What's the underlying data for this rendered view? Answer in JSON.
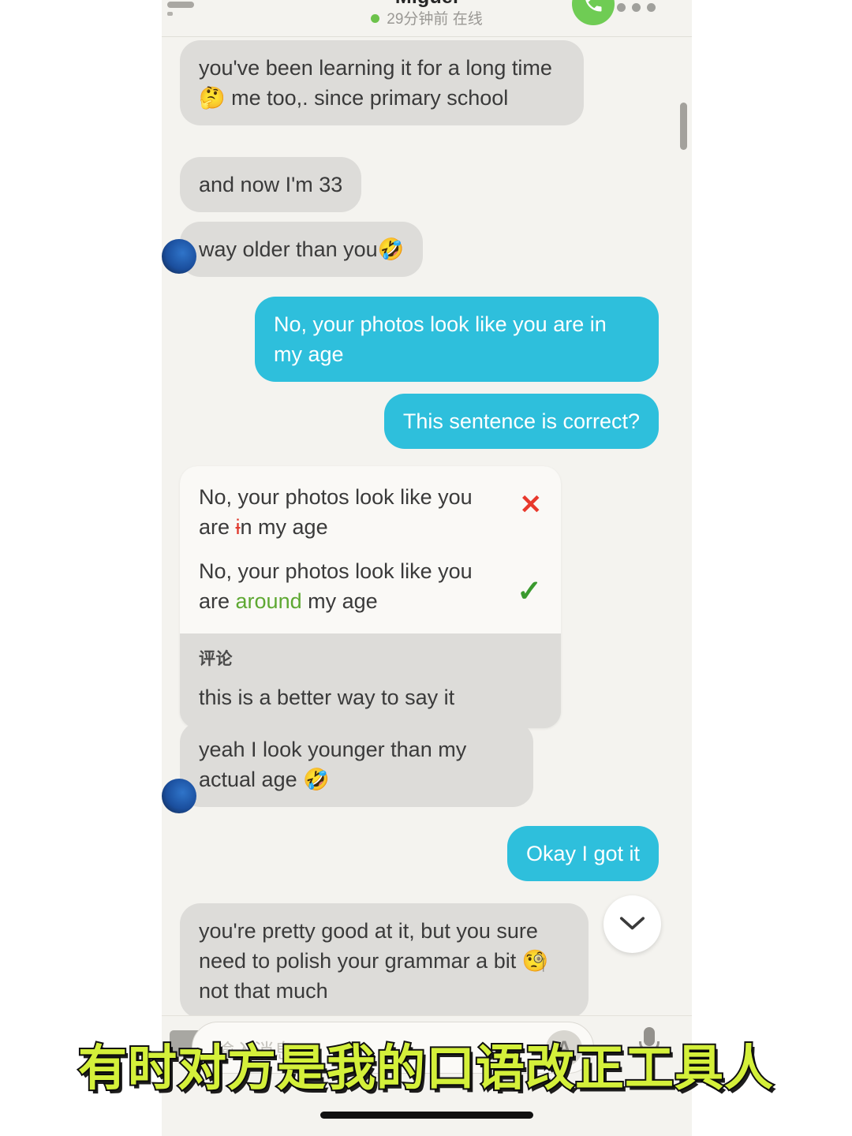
{
  "header": {
    "contact_name": "Miguel",
    "status_text": "29分钟前 在线",
    "status_dot_color": "#6cc24a",
    "call_icon": "phone-icon",
    "menu_icon": "more-options-icon",
    "back_icon": "back-arrow-icon"
  },
  "messages": [
    {
      "id": "m1",
      "side": "in",
      "text": "you've been learning it for a long time 🤔 me too,. since primary school"
    },
    {
      "id": "m2",
      "side": "in",
      "text": "and now I'm 33"
    },
    {
      "id": "m3",
      "side": "in",
      "text": "way older than you🤣"
    },
    {
      "id": "m4",
      "side": "out",
      "text": "No, your photos look like you are in my age"
    },
    {
      "id": "m5",
      "side": "out",
      "text": "This sentence is correct?"
    },
    {
      "id": "m6",
      "side": "in",
      "text": "yeah I look younger than my actual age 🤣"
    },
    {
      "id": "m7",
      "side": "out",
      "text": "Okay I got it"
    },
    {
      "id": "m8",
      "side": "in",
      "text": "you're pretty good at it, but you sure need to polish your grammar a bit 🧐 not that much"
    }
  ],
  "correction": {
    "original_prefix": "No, your photos look like you are ",
    "original_strike": "i",
    "original_suffix": "n my age",
    "corrected_prefix": "No, your photos look like you are ",
    "corrected_highlight": "around",
    "corrected_suffix": " my age",
    "wrong_mark": "✕",
    "right_mark": "✓",
    "comment_label": "评论",
    "comment_text": "this is a better way to say it",
    "wrong_color": "#e8392c",
    "right_color": "#3a9a2e",
    "highlight_color": "#5ea832"
  },
  "input_bar": {
    "placeholder": "输入消息",
    "translate_label": "A",
    "keyboard_icon": "keyboard-icon",
    "mic_icon": "microphone-icon"
  },
  "scroll_fab": {
    "icon": "chevron-down-icon"
  },
  "caption": {
    "text": "有时对方是我的口语改正工具人"
  },
  "colors": {
    "app_background": "#f4f3ef",
    "incoming_bubble": "#dddcd9",
    "outgoing_bubble": "#2ebfdc",
    "outgoing_text": "#ffffff",
    "incoming_text": "#3a3a3a",
    "caption_fill": "#d4f03a",
    "caption_stroke": "#101010",
    "call_button": "#6fcc54"
  }
}
